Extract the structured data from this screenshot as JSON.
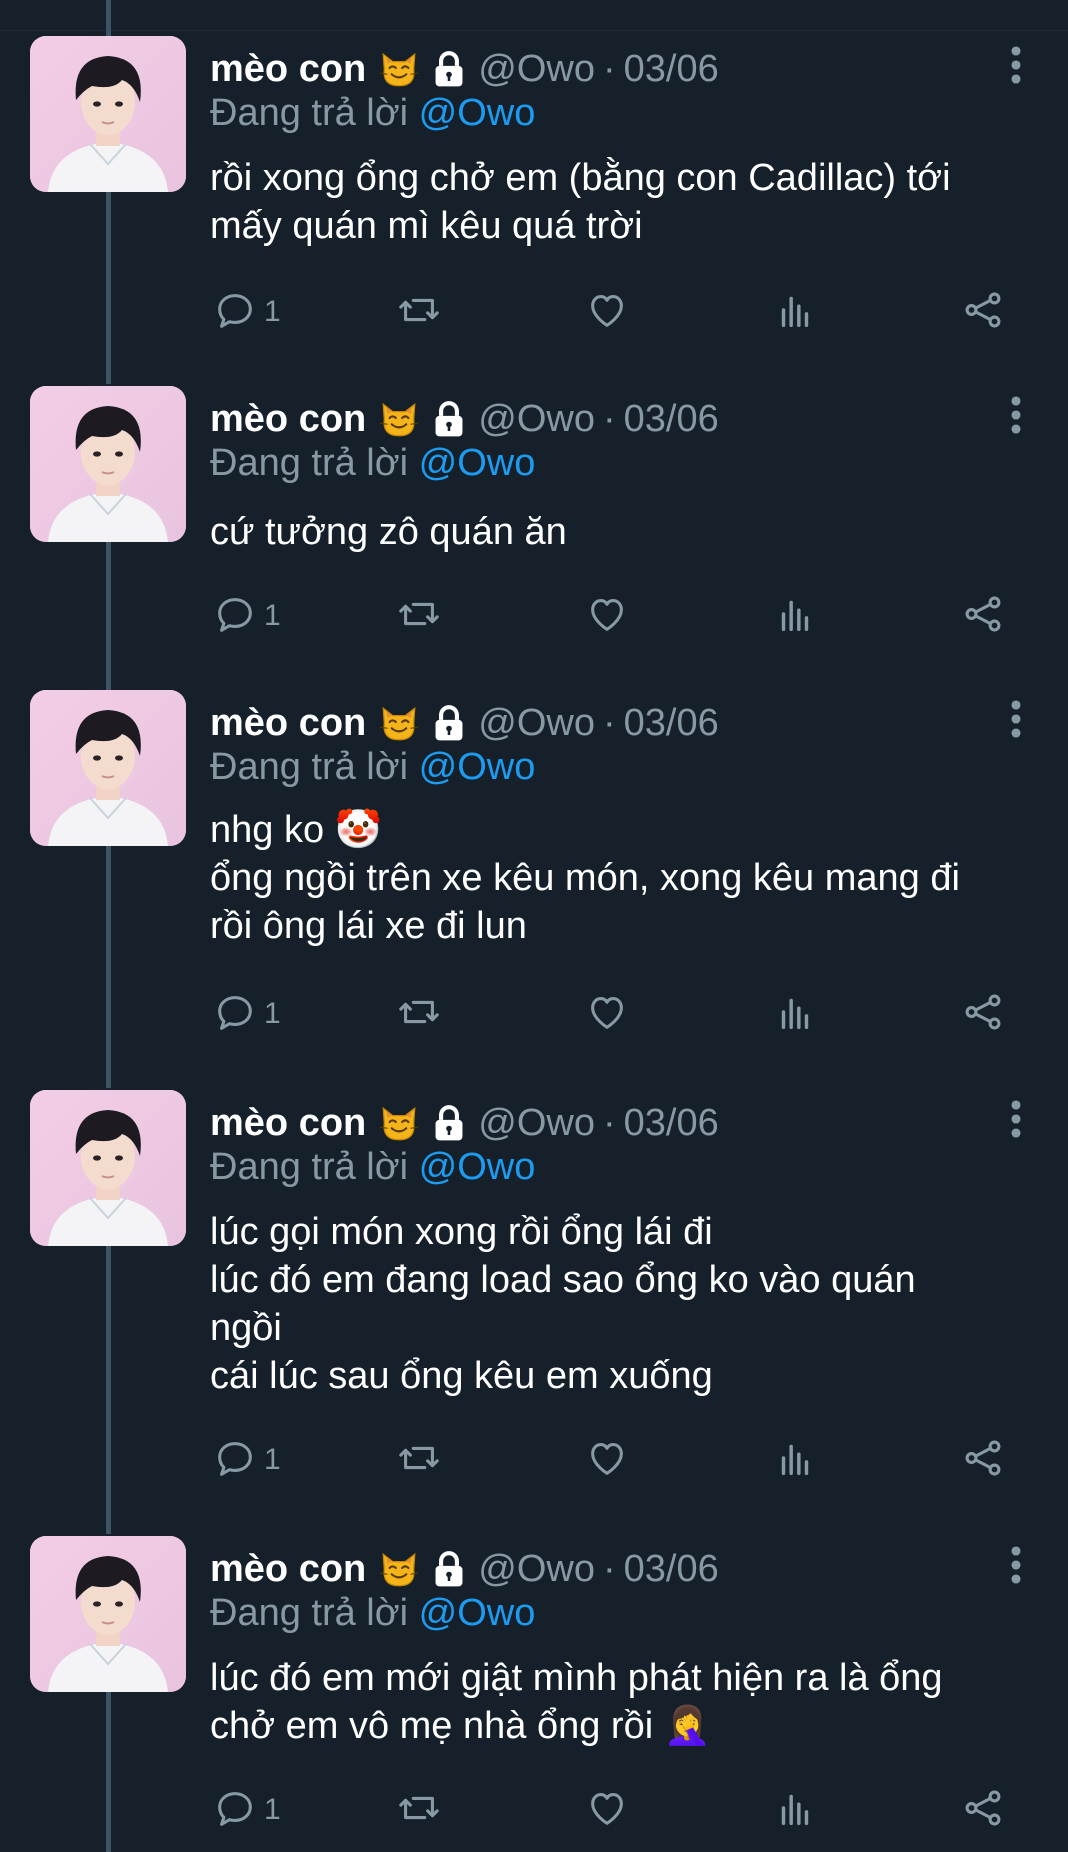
{
  "colors": {
    "background": "#15202b",
    "secondary_text": "#8899a6",
    "mention": "#1d9bf0",
    "thread_line": "#3d5466"
  },
  "tweets": [
    {
      "name": "mèo con",
      "handle": "@Owo",
      "separator": "·",
      "date": "03/06",
      "replying_prefix": "Đang trả lời",
      "replying_to": "@Owo",
      "text": "rồi xong ổng chở em (bằng con Cadillac) tới\nmấy quán mì kêu quá trời",
      "reply_count": "1",
      "icons": [
        "cat-emoji",
        "lock-icon",
        "more-icon",
        "reply-icon",
        "retweet-icon",
        "like-icon",
        "views-icon",
        "share-icon"
      ]
    },
    {
      "name": "mèo con",
      "handle": "@Owo",
      "separator": "·",
      "date": "03/06",
      "replying_prefix": "Đang trả lời",
      "replying_to": "@Owo",
      "text": "cứ tưởng zô quán ăn",
      "reply_count": "1",
      "icons": [
        "cat-emoji",
        "lock-icon",
        "more-icon",
        "reply-icon",
        "retweet-icon",
        "like-icon",
        "views-icon",
        "share-icon"
      ]
    },
    {
      "name": "mèo con",
      "handle": "@Owo",
      "separator": "·",
      "date": "03/06",
      "replying_prefix": "Đang trả lời",
      "replying_to": "@Owo",
      "text": "nhg ko 🤡\nổng ngồi trên xe kêu món, xong kêu mang đi\nrồi ông lái xe đi lun",
      "reply_count": "1",
      "icons": [
        "cat-emoji",
        "lock-icon",
        "more-icon",
        "reply-icon",
        "retweet-icon",
        "like-icon",
        "views-icon",
        "share-icon"
      ]
    },
    {
      "name": "mèo con",
      "handle": "@Owo",
      "separator": "·",
      "date": "03/06",
      "replying_prefix": "Đang trả lời",
      "replying_to": "@Owo",
      "text": "lúc gọi món xong rồi ổng lái đi\nlúc đó em đang load sao ổng ko vào quán\nngồi\ncái lúc sau ổng kêu em xuống",
      "reply_count": "1",
      "icons": [
        "cat-emoji",
        "lock-icon",
        "more-icon",
        "reply-icon",
        "retweet-icon",
        "like-icon",
        "views-icon",
        "share-icon"
      ]
    },
    {
      "name": "mèo con",
      "handle": "@Owo",
      "separator": "·",
      "date": "03/06",
      "replying_prefix": "Đang trả lời",
      "replying_to": "@Owo",
      "text": "lúc đó em mới giật mình phát hiện ra là ổng\nchở em vô mẹ nhà ổng rồi 🤦‍♀️",
      "reply_count": "1",
      "icons": [
        "cat-emoji",
        "lock-icon",
        "more-icon",
        "reply-icon",
        "retweet-icon",
        "like-icon",
        "views-icon",
        "share-icon"
      ]
    }
  ]
}
